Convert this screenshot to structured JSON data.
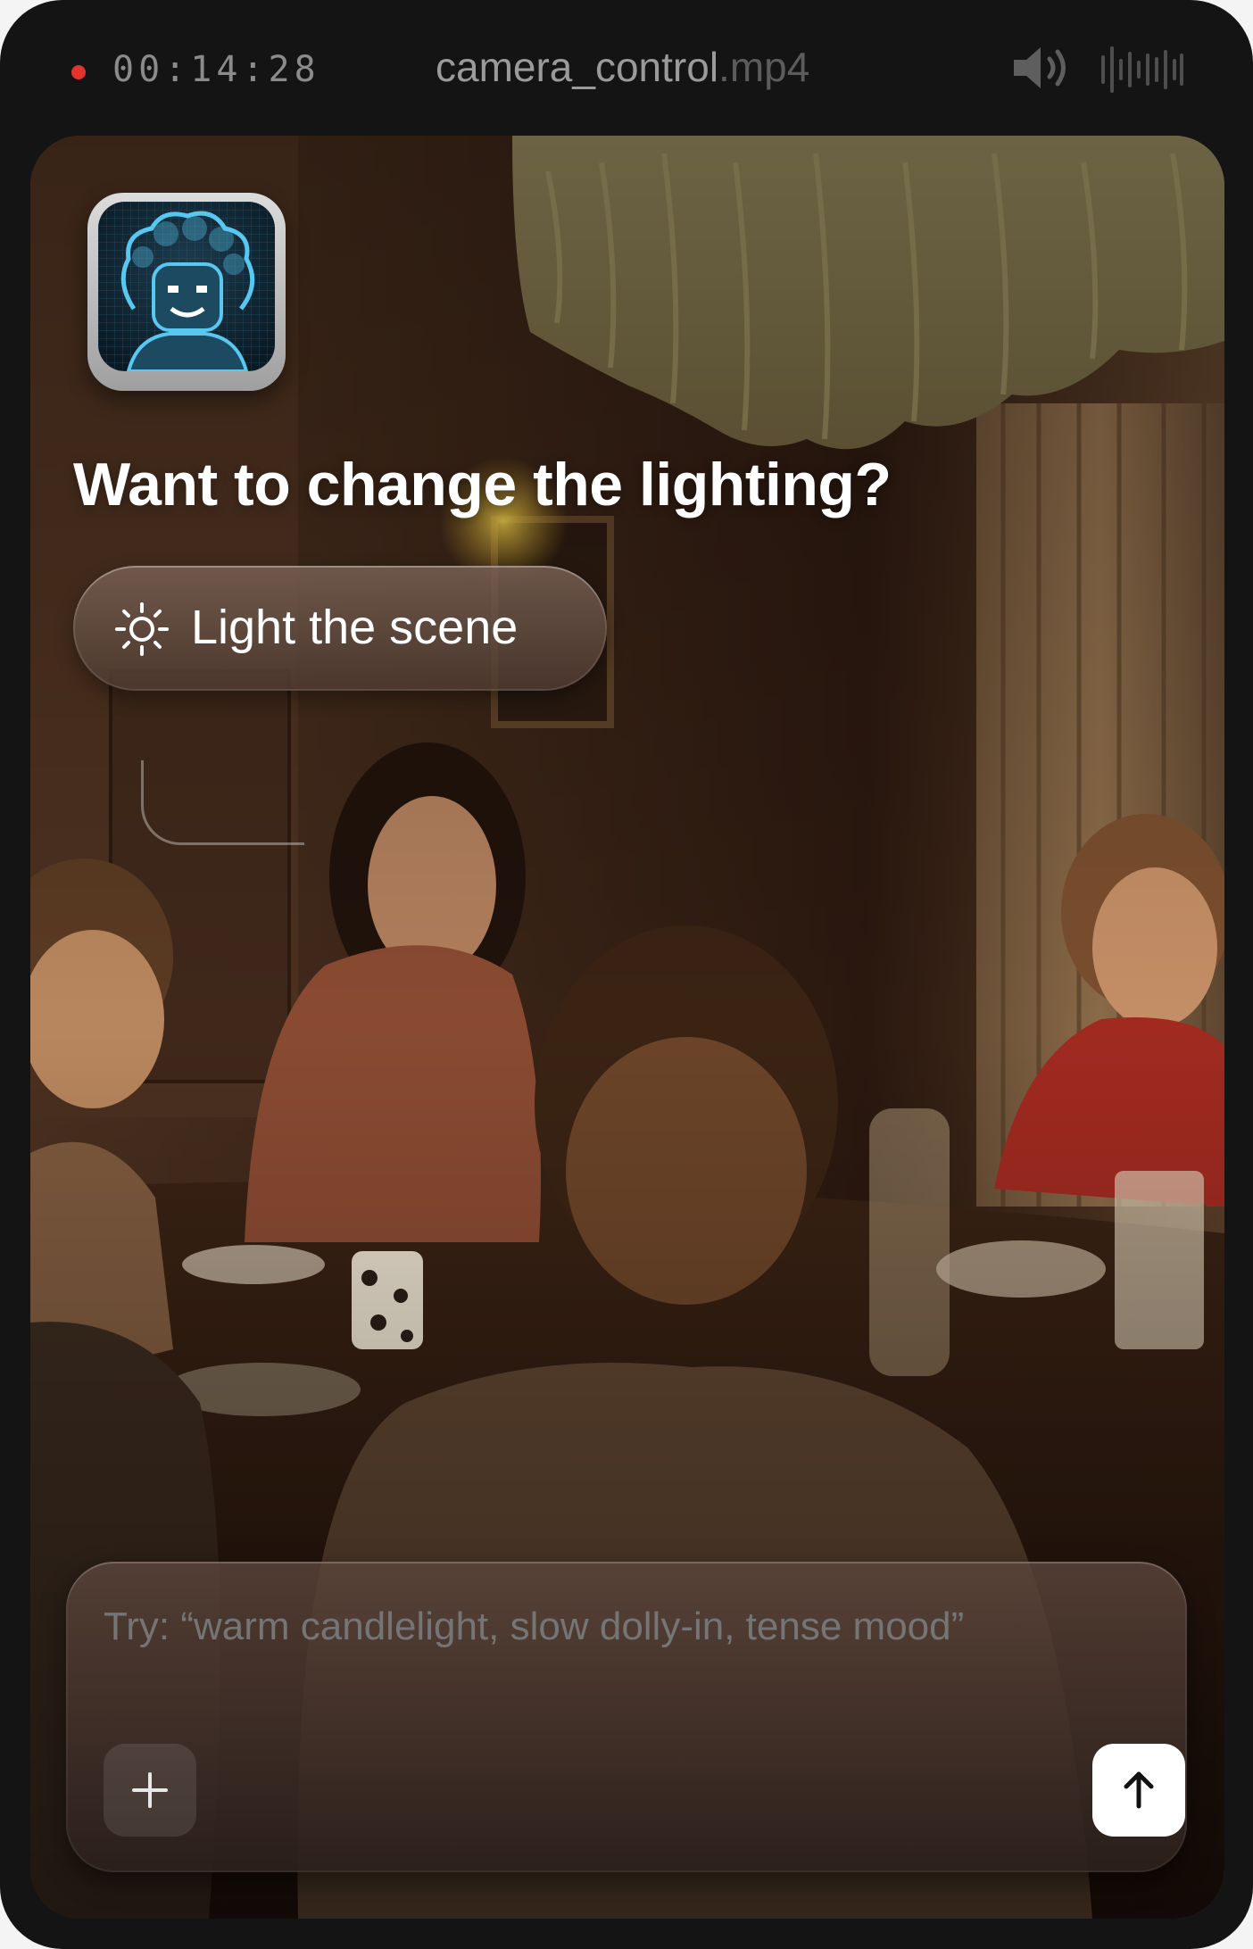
{
  "recording": {
    "indicator_color": "#e5322d",
    "timecode": "00:14:28"
  },
  "file": {
    "name": "camera_control",
    "extension": ".mp4"
  },
  "toolbar": {
    "icons": [
      "speaker-icon",
      "waveform-icon"
    ]
  },
  "assistant": {
    "avatar_icon": "pixel-avatar-icon",
    "question": "Want to change the lighting?",
    "suggestion_label": "Light the scene",
    "suggestion_icon": "sun-icon"
  },
  "composer": {
    "placeholder": "Try: “warm candlelight, slow dolly-in, tense mood”",
    "add_icon": "plus-icon",
    "send_icon": "arrow-up-icon"
  }
}
